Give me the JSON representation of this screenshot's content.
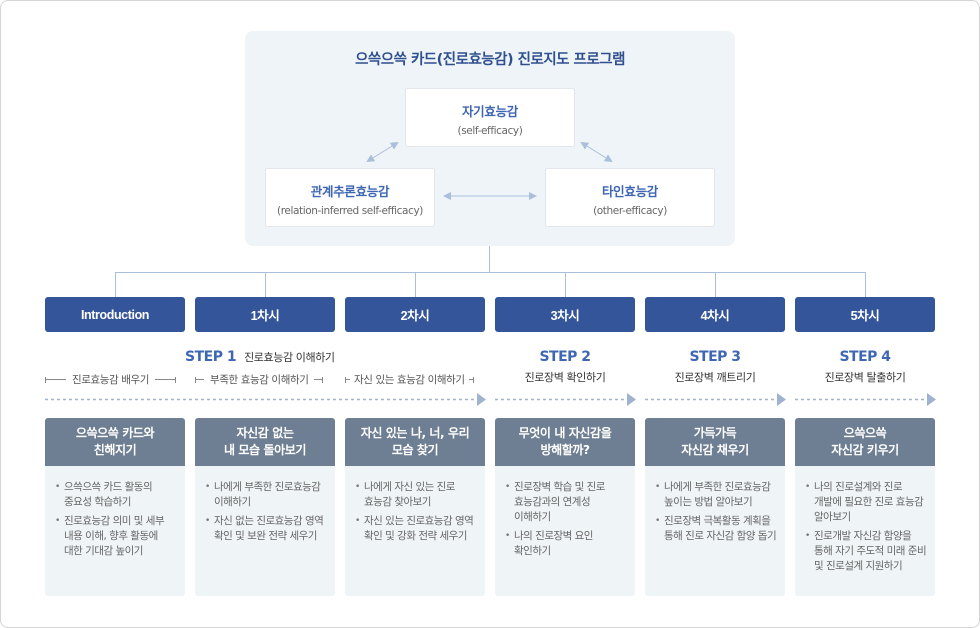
{
  "title": "으쓱으쓱 카드(진로효능감) 진로지도 프로그램",
  "concepts": {
    "self": {
      "name": "자기효능감",
      "sub": "(self-efficacy)"
    },
    "relation": {
      "name": "관계추론효능감",
      "sub": "(relation-inferred self-efficacy)"
    },
    "other": {
      "name": "타인효능감",
      "sub": "(other-efficacy)"
    }
  },
  "sessions": [
    "Introduction",
    "1차시",
    "2차시",
    "3차시",
    "4차시",
    "5차시"
  ],
  "steps": [
    {
      "label": "STEP 1",
      "desc": "진로효능감 이해하기"
    },
    {
      "label": "STEP 2",
      "desc": "진로장벽 확인하기"
    },
    {
      "label": "STEP 3",
      "desc": "진로장벽 깨트리기"
    },
    {
      "label": "STEP 4",
      "desc": "진로장벽 탈출하기"
    }
  ],
  "sub_ranges": [
    "진로효능감 배우기",
    "부족한 효능감 이해하기",
    "자신 있는 효능감 이해하기"
  ],
  "cards": [
    {
      "title": "으쓱으쓱 카드와\n친해지기",
      "items": [
        "으쓱으쓱 카드 활동의 중요성 학습하기",
        "진로효능감 의미 및 세부 내용 이해, 향후 활동에 대한 기대감 높이기"
      ]
    },
    {
      "title": "자신감 없는\n내 모습 돌아보기",
      "items": [
        "나에게 부족한 진로효능감 이해하기",
        "자신 없는 진로효능감 영역 확인 및 보완 전략 세우기"
      ]
    },
    {
      "title": "자신 있는 나, 너, 우리\n모습 찾기",
      "items": [
        "나에게 자신 있는 진로 효능감 찾아보기",
        "자신 있는 진로효능감 영역 확인 및 강화 전략 세우기"
      ]
    },
    {
      "title": "무엇이 내 자신감을\n방해할까?",
      "items": [
        "진로장벽 학습 및 진로 효능감과의 연계성 이해하기",
        "나의 진로장벽 요인 확인하기"
      ]
    },
    {
      "title": "가득가득\n자신감 채우기",
      "items": [
        "나에게 부족한 진로효능감 높이는 방법 알아보기",
        "진로장벽 극복활동 계획을 통해 진로 자신감 함양 돕기"
      ]
    },
    {
      "title": "으쓱으쓱\n자신감 키우기",
      "items": [
        "나의 진로설계와 진로 개발에 필요한 진로 효능감 알아보기",
        "진로개발 자신감 함양을 통해 자기 주도적 미래 준비 및 진로설계 지원하기"
      ]
    }
  ],
  "colors": {
    "accent": "#3f66b3",
    "button": "#34559a",
    "card_header": "#6f7f93",
    "card_body": "#eff4f7",
    "connector": "#a9c0dc"
  }
}
